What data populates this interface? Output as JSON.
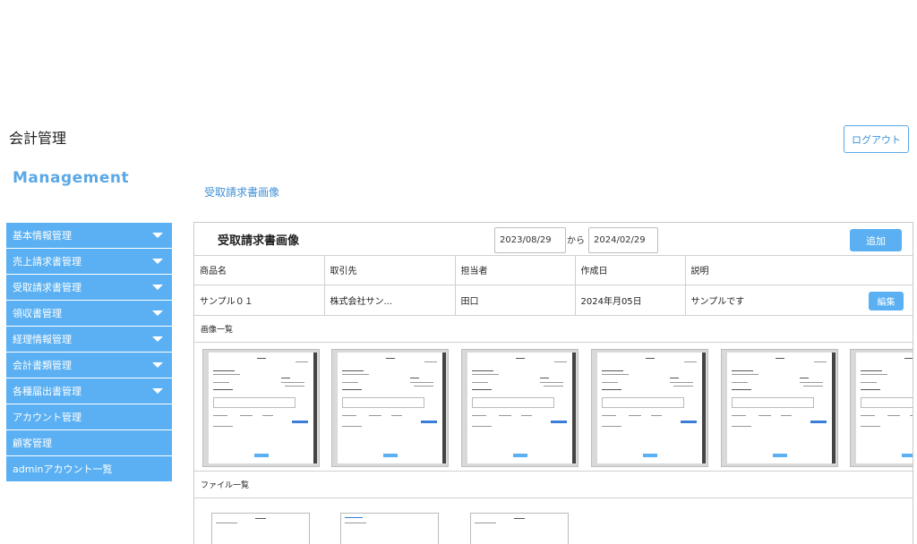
{
  "app": {
    "title": "会計管理",
    "brand": "Management",
    "logout_label": "ログアウト"
  },
  "page": {
    "heading": "受取請求書画像"
  },
  "sidebar": {
    "items": [
      {
        "label": "基本情報管理",
        "expandable": true
      },
      {
        "label": "売上請求書管理",
        "expandable": true
      },
      {
        "label": "受取請求書管理",
        "expandable": true
      },
      {
        "label": "領収書管理",
        "expandable": true
      },
      {
        "label": "経理情報管理",
        "expandable": true
      },
      {
        "label": "会計書類管理",
        "expandable": true
      },
      {
        "label": "各種届出書管理",
        "expandable": true
      },
      {
        "label": "アカウント管理",
        "expandable": false
      },
      {
        "label": "顧客管理",
        "expandable": false
      },
      {
        "label": "adminアカウント一覧",
        "expandable": false
      }
    ]
  },
  "panel": {
    "title": "受取請求書画像",
    "date_from": "2023/08/29",
    "date_separator": "から",
    "date_to": "2024/02/29",
    "add_label": "追加",
    "columns": [
      "商品名",
      "取引先",
      "担当者",
      "作成日",
      "説明"
    ],
    "row": [
      "サンプル０１",
      "株式会社サン...",
      "田口",
      "2024年月05日",
      "サンプルです"
    ],
    "edit_label": "編集",
    "images_label": "画像一覧",
    "files_label": "ファイル一覧"
  },
  "colors": {
    "accent": "#5ab0f2",
    "brand": "#5aa8e6",
    "link": "#3d8fd6"
  },
  "icons": {
    "sidebar_expand": "chevron-down-icon"
  }
}
